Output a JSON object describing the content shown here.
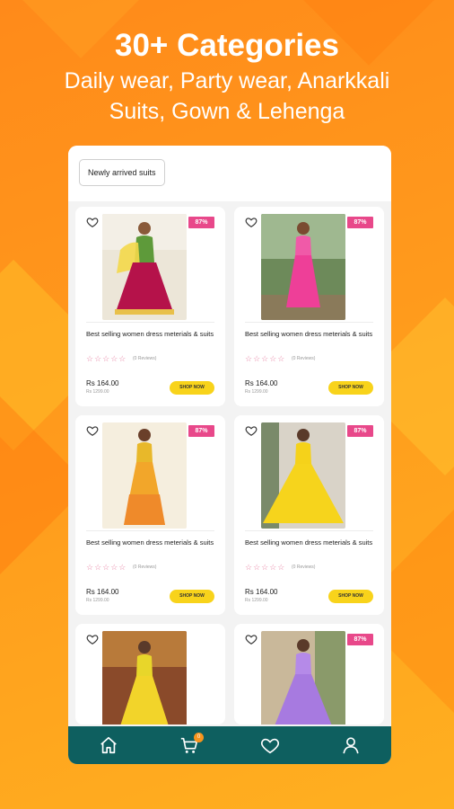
{
  "promo": {
    "title": "30+ Categories",
    "subtitle_line1": "Daily wear, Party wear, Anarkkali",
    "subtitle_line2": "Suits, Gown & Lehenga"
  },
  "app": {
    "filter_chip": "Newly arrived suits",
    "products": [
      {
        "discount": "87%",
        "title": "Best selling women dress meterials & suits",
        "reviews": "(0 Reviews)",
        "price": "Rs 164.00",
        "old_price": "Rs 1299.00",
        "button": "SHOP NOW",
        "rating": 0
      },
      {
        "discount": "87%",
        "title": "Best selling women dress meterials & suits",
        "reviews": "(0 Reviews)",
        "price": "Rs 164.00",
        "old_price": "Rs 1299.00",
        "button": "SHOP NOW",
        "rating": 0
      },
      {
        "discount": "87%",
        "title": "Best selling women dress meterials & suits",
        "reviews": "(0 Reviews)",
        "price": "Rs 164.00",
        "old_price": "Rs 1299.00",
        "button": "SHOP NOW",
        "rating": 0
      },
      {
        "discount": "87%",
        "title": "Best selling women dress meterials & suits",
        "reviews": "(0 Reviews)",
        "price": "Rs 164.00",
        "old_price": "Rs 1299.00",
        "button": "SHOP NOW",
        "rating": 0
      },
      {
        "discount": "",
        "title": "",
        "reviews": "",
        "price": "",
        "old_price": "",
        "button": ""
      },
      {
        "discount": "87%",
        "title": "",
        "reviews": "",
        "price": "",
        "old_price": "",
        "button": ""
      }
    ],
    "nav": {
      "cart_count": "0"
    },
    "colors": {
      "accent_teal": "#0e5f5f",
      "badge_pink": "#e8488a",
      "button_yellow": "#f8d31b",
      "background_orange": "#ff9a1c"
    },
    "icons": [
      "heart-icon",
      "home-icon",
      "cart-icon",
      "wishlist-icon",
      "profile-icon"
    ]
  }
}
